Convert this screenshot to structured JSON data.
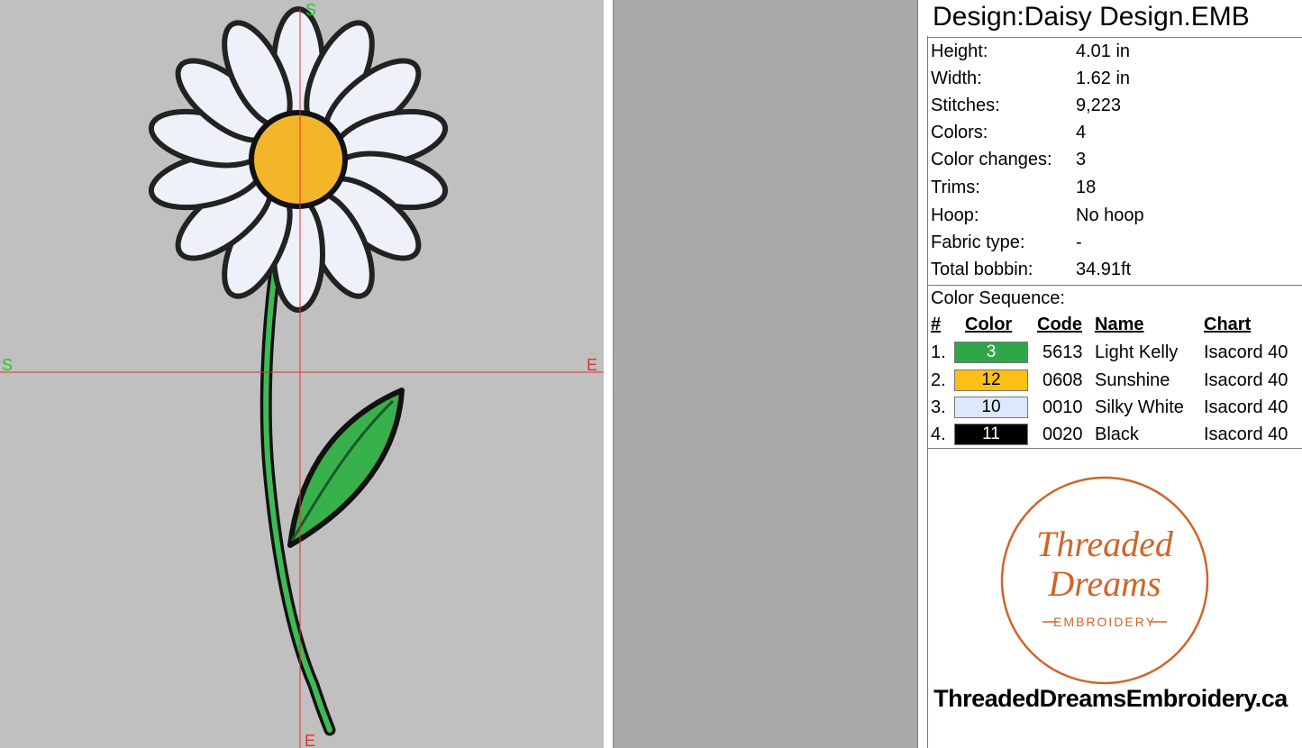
{
  "canvas": {
    "markers": {
      "top": "S",
      "bottom": "E",
      "left": "S",
      "right": "E"
    },
    "colors": {
      "background": "#c0c0c0",
      "crosshair": "#e03030",
      "marker": "#22cc22"
    }
  },
  "info": {
    "title": "Design:Daisy Design.EMB",
    "properties": [
      {
        "label": "Height:",
        "value": "4.01 in"
      },
      {
        "label": "Width:",
        "value": "1.62 in"
      },
      {
        "label": "Stitches:",
        "value": "9,223"
      },
      {
        "label": "Colors:",
        "value": "4"
      },
      {
        "label": "Color changes:",
        "value": "3"
      },
      {
        "label": "Trims:",
        "value": "18"
      },
      {
        "label": "Hoop:",
        "value": "No hoop"
      },
      {
        "label": "Fabric type:",
        "value": "-"
      },
      {
        "label": "Total bobbin:",
        "value": "34.91ft"
      }
    ],
    "sequence_title": "Color Sequence:",
    "headers": {
      "num": "#",
      "color": "Color",
      "code": "Code",
      "name": "Name",
      "chart": "Chart"
    },
    "sequence": [
      {
        "num": "1.",
        "swatch": "3",
        "hex": "#2ea64a",
        "text_color": "#ffffff",
        "code": "5613",
        "name": "Light Kelly",
        "chart": "Isacord 40"
      },
      {
        "num": "2.",
        "swatch": "12",
        "hex": "#fbbf16",
        "text_color": "#000000",
        "code": "0608",
        "name": "Sunshine",
        "chart": "Isacord 40"
      },
      {
        "num": "3.",
        "swatch": "10",
        "hex": "#dde8fb",
        "text_color": "#000000",
        "code": "0010",
        "name": "Silky White",
        "chart": "Isacord 40"
      },
      {
        "num": "4.",
        "swatch": "11",
        "hex": "#000000",
        "text_color": "#ffffff",
        "code": "0020",
        "name": "Black",
        "chart": "Isacord 40"
      }
    ],
    "logo": {
      "line1": "Threaded",
      "line2": "Dreams",
      "line3": "EMBROIDERY",
      "color": "#d0642a"
    },
    "website": "ThreadedDreamsEmbroidery.ca"
  }
}
